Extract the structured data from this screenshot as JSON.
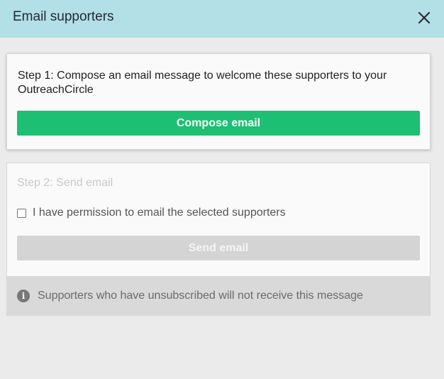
{
  "header": {
    "title": "Email supporters",
    "close_icon": "close-icon"
  },
  "step1": {
    "text": "Step 1: Compose an email message to welcome these supporters to your OutreachCircle",
    "button_label": "Compose email",
    "button_color": "#1dbf73"
  },
  "step2": {
    "title": "Step 2: Send email",
    "permission_label": "I have permission to email the selected supporters",
    "permission_checked": false,
    "button_label": "Send email",
    "button_state": "disabled"
  },
  "notice": {
    "icon": "info-icon",
    "text": "Supporters who have unsubscribed will not receive this message"
  },
  "colors": {
    "header_bg": "#b3dfe6",
    "page_bg": "#ebebeb"
  }
}
